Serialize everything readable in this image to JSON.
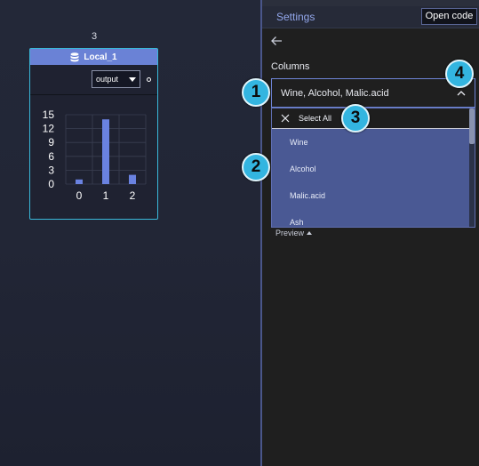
{
  "canvas": {
    "node_count": "3",
    "node": {
      "title": "Local_1",
      "title_icon": "database-icon",
      "output_select": "output"
    }
  },
  "chart_data": {
    "type": "bar",
    "categories": [
      "0",
      "1",
      "2"
    ],
    "values": [
      1,
      14,
      2
    ],
    "ylim": [
      0,
      15
    ],
    "yticks": [
      "15",
      "12",
      "9",
      "6",
      "3",
      "0"
    ],
    "title": "",
    "xlabel": "",
    "ylabel": "",
    "color": "#6a82e0",
    "grid": true
  },
  "panel": {
    "title": "Settings",
    "open_code": "Open code",
    "back_icon": "arrow-left-icon",
    "columns_label": "Columns",
    "selected_value": "Wine, Alcohol, Malic.acid",
    "select_all": "Select All",
    "options": [
      "Wine",
      "Alcohol",
      "Malic.acid",
      "Ash"
    ],
    "preview": "Preview"
  },
  "badges": [
    "1",
    "2",
    "3",
    "4"
  ],
  "colors": {
    "accent": "#6a82d6",
    "node_border": "#39b7d8",
    "badge": "#33b5e0",
    "dropdown_selected": "#4a5994"
  }
}
